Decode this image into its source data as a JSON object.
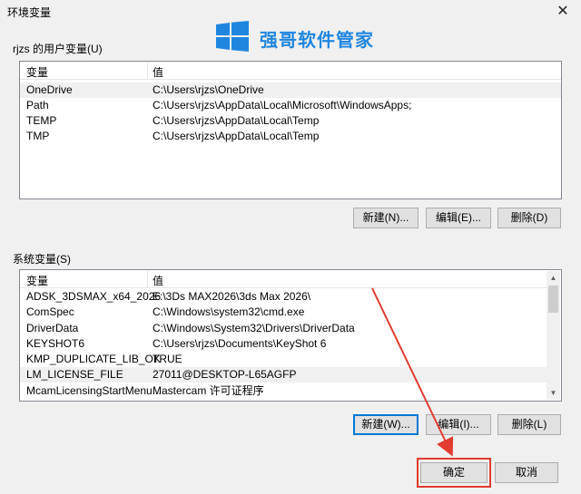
{
  "window": {
    "title": "环境变量",
    "close_glyph": "✕"
  },
  "watermark": {
    "text": "强哥软件管家",
    "color": "#1f86e0",
    "logo_icon": "windows-logo-icon"
  },
  "user_vars": {
    "group_label": "rjzs 的用户变量(U)",
    "col_variable": "变量",
    "col_value": "值",
    "rows": [
      {
        "name": "OneDrive",
        "value": "C:\\Users\\rjzs\\OneDrive"
      },
      {
        "name": "Path",
        "value": "C:\\Users\\rjzs\\AppData\\Local\\Microsoft\\WindowsApps;"
      },
      {
        "name": "TEMP",
        "value": "C:\\Users\\rjzs\\AppData\\Local\\Temp"
      },
      {
        "name": "TMP",
        "value": "C:\\Users\\rjzs\\AppData\\Local\\Temp"
      }
    ],
    "buttons": {
      "new": "新建(N)...",
      "edit": "编辑(E)...",
      "delete": "删除(D)"
    }
  },
  "system_vars": {
    "group_label": "系统变量(S)",
    "col_variable": "变量",
    "col_value": "值",
    "rows": [
      {
        "name": "ADSK_3DSMAX_x64_2026",
        "value": "E:\\3Ds MAX2026\\3ds Max 2026\\"
      },
      {
        "name": "ComSpec",
        "value": "C:\\Windows\\system32\\cmd.exe"
      },
      {
        "name": "DriverData",
        "value": "C:\\Windows\\System32\\Drivers\\DriverData"
      },
      {
        "name": "KEYSHOT6",
        "value": "C:\\Users\\rjzs\\Documents\\KeyShot 6"
      },
      {
        "name": "KMP_DUPLICATE_LIB_OK",
        "value": "TRUE"
      },
      {
        "name": "LM_LICENSE_FILE",
        "value": "27011@DESKTOP-L65AGFP"
      },
      {
        "name": "McamLicensingStartMenu...",
        "value": "Mastercam 许可证程序"
      }
    ],
    "buttons": {
      "new": "新建(W)...",
      "edit": "编辑(I)...",
      "delete": "删除(L)"
    }
  },
  "footer": {
    "ok": "确定",
    "cancel": "取消"
  },
  "annotation": {
    "color": "#e23b30"
  }
}
